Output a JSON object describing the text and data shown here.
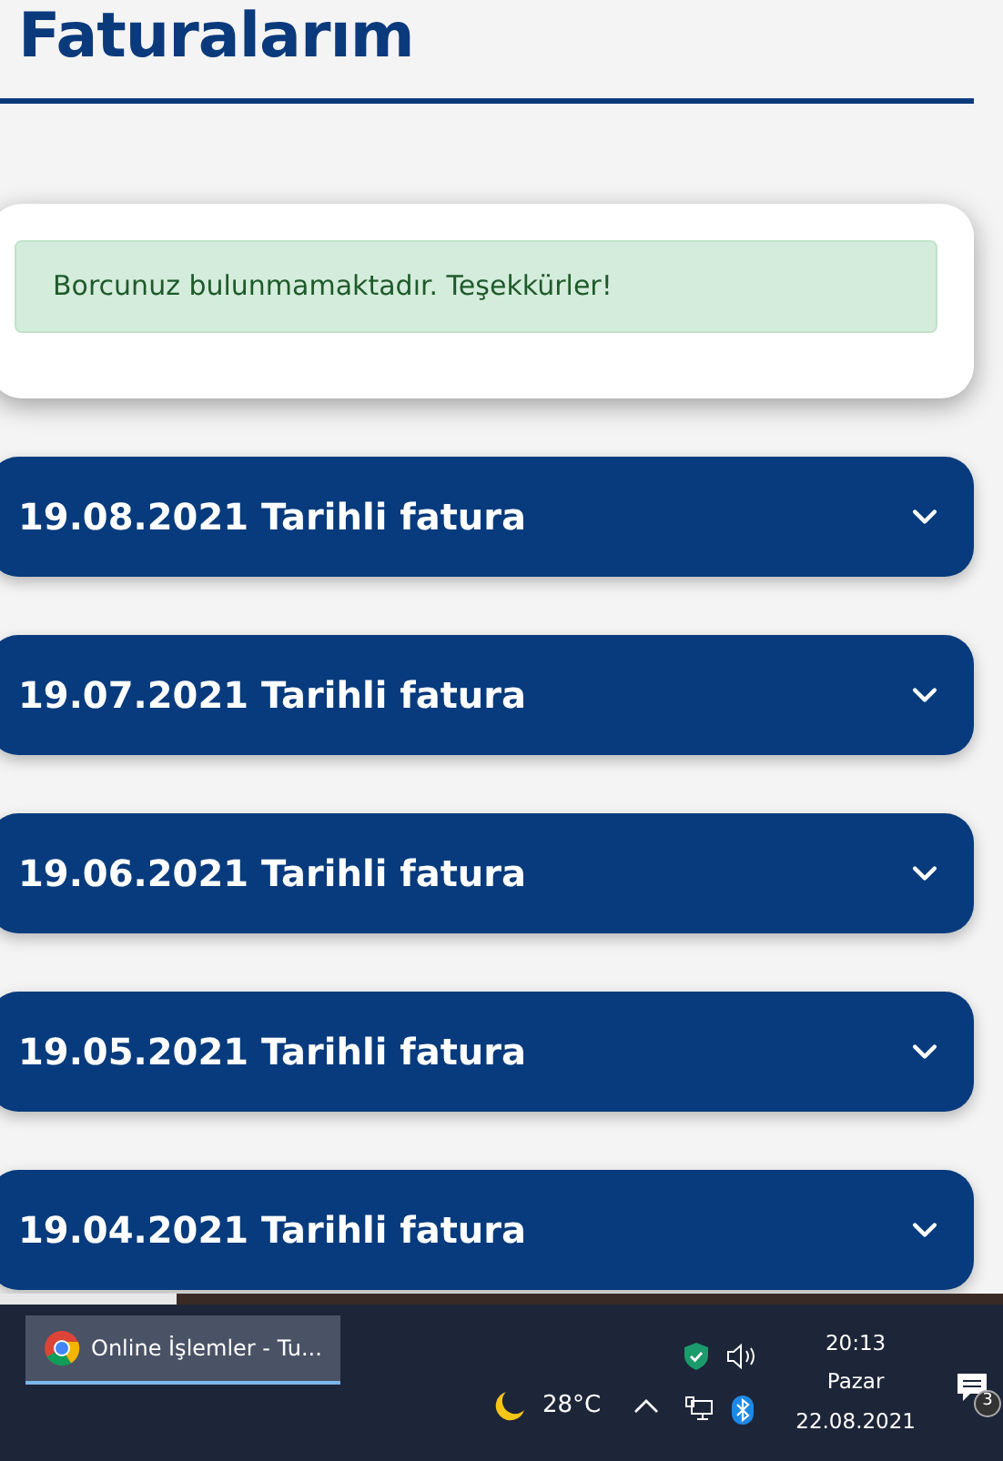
{
  "page_title": "Faturalarım",
  "alert": {
    "text": "Borcunuz bulunmamaktadır. Teşekkürler!"
  },
  "invoices": [
    {
      "title": "19.08.2021 Tarihli fatura",
      "expanded": false
    },
    {
      "title": "19.07.2021 Tarihli fatura",
      "expanded": false
    },
    {
      "title": "19.06.2021 Tarihli fatura",
      "expanded": false
    },
    {
      "title": "19.05.2021 Tarihli fatura",
      "expanded": false
    },
    {
      "title": "19.04.2021 Tarihli fatura",
      "expanded": false
    }
  ],
  "taskbar": {
    "app": {
      "label": "Online İşlemler - Tu...",
      "selected": true
    },
    "weather": "28°C",
    "time": "20:13",
    "day": "Pazar",
    "date": "22.08.2021",
    "notifications": "3"
  }
}
